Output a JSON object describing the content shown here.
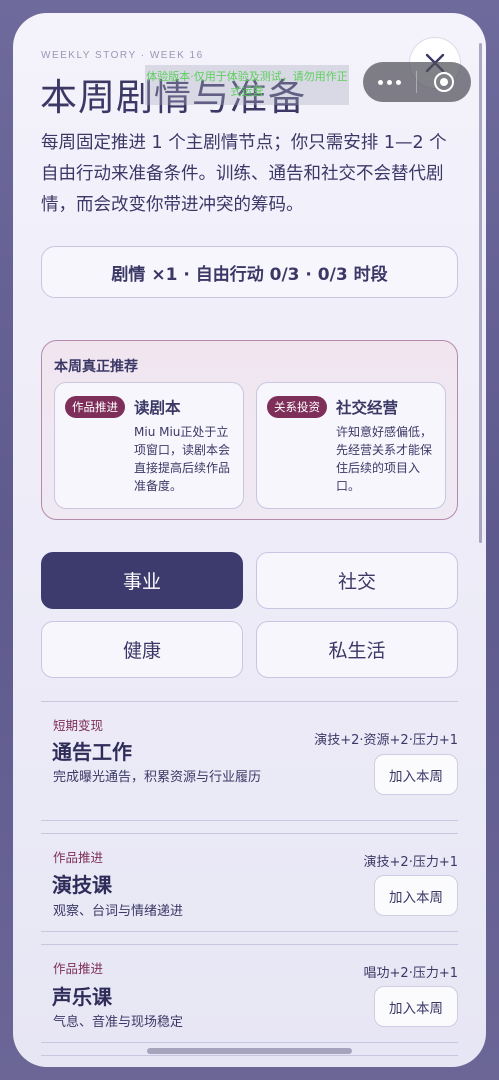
{
  "header": {
    "kicker": "WEEKLY STORY · WEEK 16",
    "title": "本周剧情与准备",
    "intro": "每周固定推进 1 个主剧情节点；你只需安排 1—2 个自由行动来准备条件。训练、通告和社交不会替代剧情，而会改变你带进冲突的筹码。"
  },
  "dev_overlay": "体验版本·仅用于体验及测试，请勿用作正式运营",
  "summary": "剧情 ×1 · 自由行动 0/3 · 0/3 时段",
  "recommend": {
    "title": "本周真正推荐",
    "cards": [
      {
        "tag": "作品推进",
        "name": "读剧本",
        "desc": "Miu Miu正处于立项窗口，读剧本会直接提高后续作品准备度。"
      },
      {
        "tag": "关系投资",
        "name": "社交经营",
        "desc": "许知意好感偏低，先经营关系才能保住后续的项目入口。"
      }
    ]
  },
  "categories": [
    {
      "label": "事业",
      "active": true
    },
    {
      "label": "社交",
      "active": false
    },
    {
      "label": "健康",
      "active": false
    },
    {
      "label": "私生活",
      "active": false
    }
  ],
  "activities": [
    {
      "category": "短期变现",
      "name": "通告工作",
      "desc": "完成曝光通告，积累资源与行业履历",
      "effect": "演技+2·资源+2·压力+1",
      "button": "加入本周"
    },
    {
      "category": "作品推进",
      "name": "演技课",
      "desc": "观察、台词与情绪递进",
      "effect": "演技+2·压力+1",
      "button": "加入本周"
    },
    {
      "category": "作品推进",
      "name": "声乐课",
      "desc": "气息、音准与现场稳定",
      "effect": "唱功+2·压力+1",
      "button": "加入本周"
    }
  ],
  "icons": {
    "close": "close-icon",
    "more": "more-dots-icon",
    "mini": "record-target-icon"
  },
  "colors": {
    "primary": "#3d3a6e",
    "tag": "#7d2f5a",
    "accent_border": "#b48aab"
  }
}
